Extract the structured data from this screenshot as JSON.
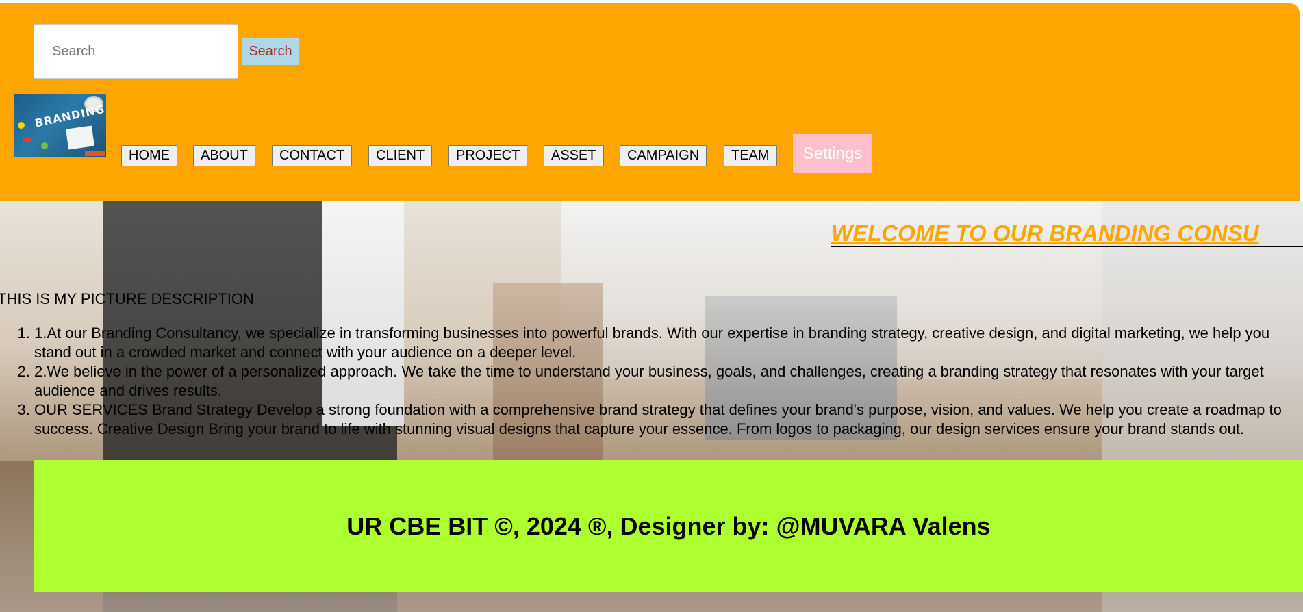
{
  "search": {
    "placeholder": "Search",
    "button_label": "Search"
  },
  "logo": {
    "text": "BRANDING"
  },
  "nav": {
    "items": [
      "HOME",
      "ABOUT",
      "CONTACT",
      "CLIENT",
      "PROJECT",
      "ASSET",
      "CAMPAIGN",
      "TEAM"
    ],
    "settings_label": "Settings"
  },
  "hero": {
    "welcome": "WELCOME TO OUR BRANDING CONSU",
    "picture_description": "THIS IS MY PICTURE DESCRIPTION",
    "list": [
      "1.At our Branding Consultancy, we specialize in transforming businesses into powerful brands. With our expertise in branding strategy, creative design, and digital marketing, we help you stand out in a crowded market and connect with your audience on a deeper level.",
      "2.We believe in the power of a personalized approach. We take the time to understand your business, goals, and challenges, creating a branding strategy that resonates with your target audience and drives results.",
      "OUR SERVICES Brand Strategy Develop a strong foundation with a comprehensive brand strategy that defines your brand's purpose, vision, and values. We help you create a roadmap to success. Creative Design Bring your brand to life with stunning visual designs that capture your essence. From logos to packaging, our design services ensure your brand stands out."
    ]
  },
  "footer": {
    "text": "UR CBE BIT ©, 2024 ®, Designer by: @MUVARA Valens"
  },
  "colors": {
    "header_bg": "#ffa500",
    "search_button_bg": "#add8e6",
    "search_button_text": "#a52a2a",
    "settings_bg": "#ffc0cb",
    "welcome_text": "#ffa500",
    "footer_bg": "#adff2f"
  }
}
